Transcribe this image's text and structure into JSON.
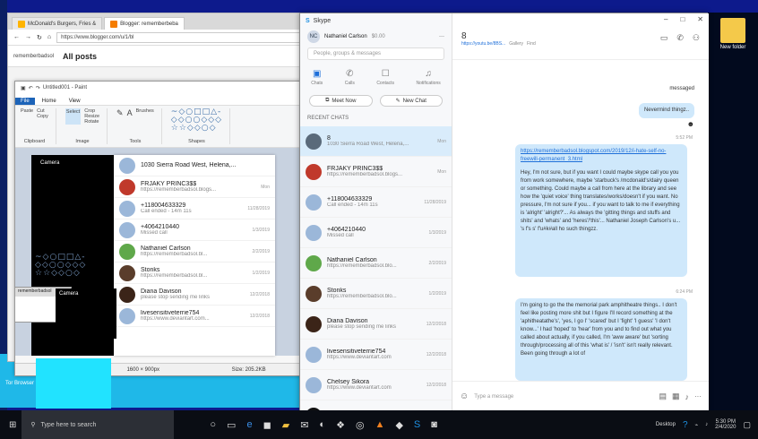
{
  "browser": {
    "tabs": [
      "McDonald's Burgers, Fries &",
      "Blogger: rememberbeba"
    ],
    "url": "https://www.blogger.com/u/1/bl",
    "blog_name": "rememberbadsol",
    "blog_section": "All posts"
  },
  "paint": {
    "title": "Untitled001 - Paint",
    "menu": [
      "File",
      "Home",
      "View"
    ],
    "groups": [
      "Clipboard",
      "Image",
      "Tools",
      "Shapes"
    ],
    "buttons": {
      "paste": "Paste",
      "cut": "Cut",
      "copy": "Copy",
      "crop": "Crop",
      "resize": "Resize",
      "rotate": "Rotate",
      "select": "Select",
      "brushes": "Brushes",
      "outline": "Outline",
      "fill": "Fill"
    },
    "status_size": "1600 × 900px",
    "status_file": "Size: 205.2KB"
  },
  "camera_label": "Camera",
  "mini_chat": [
    {
      "name": "1030 Sierra Road West, Helena,...",
      "sub": "",
      "date": ""
    },
    {
      "name": "FRJAKY PRINC3$$",
      "sub": "https://rememberbadsol.blogs...",
      "date": "Mon",
      "color": "#c0392b"
    },
    {
      "name": "+118004633329",
      "sub": "Call ended - 14m 11s",
      "date": "11/28/2019",
      "color": "#9bb7d9"
    },
    {
      "name": "+4064210440",
      "sub": "Missed call",
      "date": "1/3/2019",
      "color": "#9bb7d9"
    },
    {
      "name": "Nathaniel Carlson",
      "sub": "https://rememberbadsol.bl...",
      "date": "2/2/2019",
      "color": "#5fa84a"
    },
    {
      "name": "Stonks",
      "sub": "https://rememberbadsol.bl...",
      "date": "1/2/2019",
      "color": "#5a3d2b"
    },
    {
      "name": "Diana Davison",
      "sub": "please stop sending me links",
      "date": "12/2/2018",
      "color": "#3b2418"
    },
    {
      "name": "livesensitiveterrie754",
      "sub": "https://www.deviantart.com...",
      "date": "12/2/2018",
      "color": "#9bb7d9"
    }
  ],
  "skype": {
    "title": "Skype",
    "profile_name": "Nathaniel Carlson",
    "profile_balance": "$0.00",
    "search_placeholder": "People, groups & messages",
    "nav": [
      "Chats",
      "Calls",
      "Contacts",
      "Notifications"
    ],
    "btn_meet": "Meet Now",
    "btn_new_chat": "New Chat",
    "recent_label": "RECENT CHATS",
    "chats": [
      {
        "name": "8",
        "sub": "1030 Sierra Road West, Helena,...",
        "date": "Mon",
        "color": "#5a6a7a",
        "selected": true
      },
      {
        "name": "FRJAKY PRINC3$$",
        "sub": "https://rememberbadsol.blogs...",
        "date": "Mon",
        "color": "#c0392b"
      },
      {
        "name": "+118004633329",
        "sub": "Call ended - 14m 11s",
        "date": "11/28/2019",
        "color": "#9bb7d9"
      },
      {
        "name": "+4064210440",
        "sub": "Missed call",
        "date": "1/3/2019",
        "color": "#9bb7d9"
      },
      {
        "name": "Nathaniel Carlson",
        "sub": "https://rememberbadsol.blo...",
        "date": "2/2/2019",
        "color": "#5fa84a"
      },
      {
        "name": "Stonks",
        "sub": "https://rememberbadsol.blo...",
        "date": "1/2/2019",
        "color": "#5a3d2b"
      },
      {
        "name": "Diana Davison",
        "sub": "please stop sending me links",
        "date": "12/2/2018",
        "color": "#3b2418"
      },
      {
        "name": "livesensitiveterrie754",
        "sub": "https://www.deviantart.com",
        "date": "12/2/2018",
        "color": "#9bb7d9"
      },
      {
        "name": "Chelsey Sikora",
        "sub": "https://www.deviantart.com",
        "date": "12/2/2018",
        "color": "#9bb7d9"
      },
      {
        "name": "Nathaniel (",
        "sub": "",
        "date": "",
        "color": "#111111"
      }
    ],
    "conv_name": "8",
    "conv_sub": "https://youtu.be/8BS...",
    "conv_gallery": "Gallery",
    "conv_find": "Find",
    "msg_messaged": "messaged",
    "msg_nevermind": "Nevermind thingz..",
    "time_1": "5:52 PM",
    "link_text": "https://rememberbadsol.blogspot.com/2019/12/i-hate-self-no-freewill-permanent_3.html",
    "msg_long1": "Hey, I'm not sure, but if you want I could maybe skype call you you from work somewhere, maybe 'starbuck's /mcdonald's/dairy queen or something. Could maybe a call from here at the library and see how the 'quiet voice' thing translates/works/doesn't if you want. No pressure, I'm not sure if you... if you want to talk to me if everything is 'alright' 'alright?'... As always the 'gitting things and stuffs and shits' and 'whats' and 'heres'/'this'... Nathaniel Joseph Carlson's u... 's f's s' f'u#k#all ho such thingzz.",
    "time_2": "6:24 PM",
    "msg_long2": "I'm going to go the the memorial park amphitheatre things.. I don't feel like posting more shit but I figure I'll record something at the 'aphitheatathe's', 'yes, I go I' 'scared' but I 'fight' 'I guess' 'I don't know...' I had 'hoped' to 'hear' from you and to find out what you called about actually, if you called, I'm 'aww aware' but 'sorting through/processing all of this 'what is' / 'isn't' isn't really relevant. Been going through a lot of",
    "composer_placeholder": "Type a message"
  },
  "desktop": {
    "new_folder": "New folder",
    "for_browser": "Tor Browser"
  },
  "taskbar": {
    "search": "Type here to search",
    "desktop": "Desktop",
    "time": "5:30 PM",
    "date": "2/4/2020"
  }
}
